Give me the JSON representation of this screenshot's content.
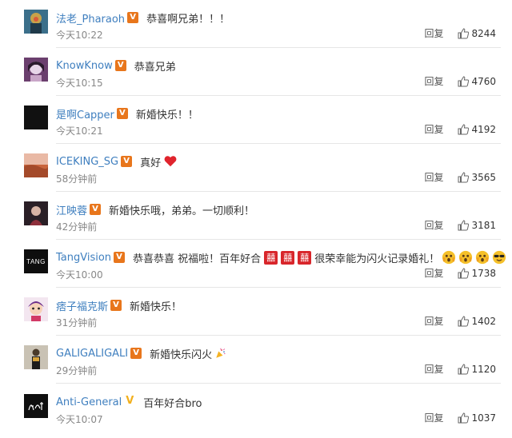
{
  "reply_label": "回复",
  "comments": [
    {
      "user": "法老_Pharaoh",
      "badge": "red",
      "text": "恭喜啊兄弟！！！",
      "time": "今天10:22",
      "likes": "8244"
    },
    {
      "user": "KnowKnow",
      "badge": "red",
      "text": "恭喜兄弟",
      "time": "今天10:15",
      "likes": "4760"
    },
    {
      "user": "是啊Capper",
      "badge": "red",
      "text": "新婚快乐！！",
      "time": "今天10:21",
      "likes": "4192"
    },
    {
      "user": "ICEKING_SG",
      "badge": "red",
      "text": "真好",
      "time": "58分钟前",
      "likes": "3565"
    },
    {
      "user": "江映蓉",
      "badge": "red",
      "text": "新婚快乐哦，弟弟。一切顺利！",
      "time": "42分钟前",
      "likes": "3181"
    },
    {
      "user": "TangVision",
      "badge": "red",
      "text_a": "恭喜恭喜 祝福啦！百年好合",
      "text_b": "很荣幸能为闪火记录婚礼！",
      "xi": "囍",
      "avatar_text": "TANG",
      "time": "今天10:00",
      "likes": "1738"
    },
    {
      "user": "痞子福克斯",
      "badge": "red",
      "text": "新婚快乐！",
      "time": "31分钟前",
      "likes": "1402"
    },
    {
      "user": "GALIGALIGALI",
      "badge": "red",
      "text": "新婚快乐闪火",
      "time": "29分钟前",
      "likes": "1120"
    },
    {
      "user": "Anti-General",
      "badge": "gold",
      "text": "百年好合bro",
      "time": "今天10:07",
      "likes": "1037"
    }
  ],
  "icons": {
    "like": "thumbs-up-icon",
    "verified": "verified-v-icon"
  },
  "colors": {
    "username": "#3f7fbf",
    "badge_red": "#e8761c",
    "badge_gold": "#f2b01e",
    "heart": "#e0242d",
    "xi": "#d8262b"
  }
}
